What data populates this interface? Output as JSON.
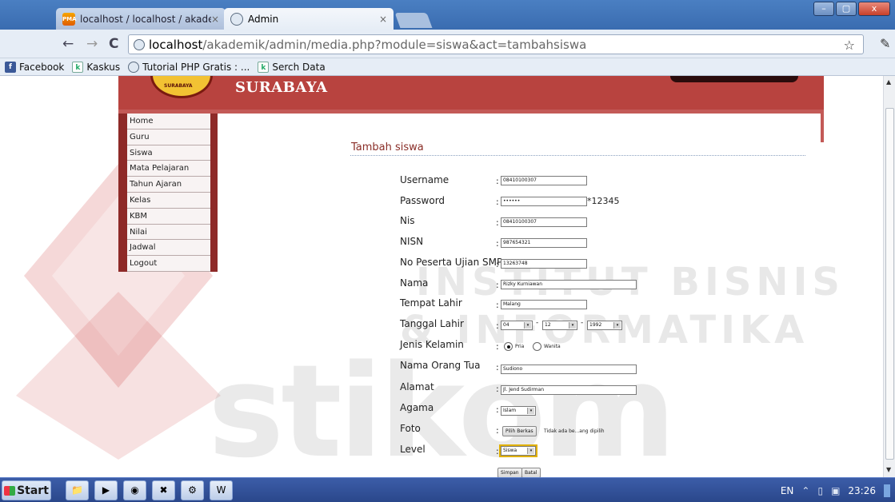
{
  "browser": {
    "tabs": [
      {
        "title": "localhost / localhost / akademi",
        "favicon": "phpmyadmin-icon",
        "active": false
      },
      {
        "title": "Admin",
        "favicon": "globe-icon",
        "active": true
      }
    ],
    "tab_close_glyph": "×",
    "address": {
      "host": "localhost",
      "path": "/akademik/admin/media.php?module=siswa&act=tambahsiswa"
    },
    "bookmarks": [
      {
        "label": "Facebook",
        "icon": "facebook-icon"
      },
      {
        "label": "Kaskus",
        "icon": "kaskus-icon"
      },
      {
        "label": "Tutorial PHP Gratis : ...",
        "icon": "globe-icon"
      },
      {
        "label": "Serch Data",
        "icon": "kaskus-icon"
      }
    ],
    "window_buttons": {
      "minimize": "–",
      "maximize": "▢",
      "close": "x"
    }
  },
  "site": {
    "brand": "SURABAYA",
    "seal_text": "SURABAYA"
  },
  "menu": {
    "items": [
      "Home",
      "Guru",
      "Siswa",
      "Mata Pelajaran",
      "Tahun Ajaran",
      "Kelas",
      "KBM",
      "Nilai",
      "Jadwal",
      "Logout"
    ]
  },
  "form": {
    "title": "Tambah siswa",
    "colon": ":",
    "username": {
      "label": "Username",
      "value": "08410100307"
    },
    "password": {
      "label": "Password",
      "value": "••••••",
      "hint": "*12345"
    },
    "nis": {
      "label": "Nis",
      "value": "08410100307"
    },
    "nisn": {
      "label": "NISN",
      "value": "987654321"
    },
    "no_peserta": {
      "label": "No Peserta Ujian SMP",
      "value": "13263748"
    },
    "nama": {
      "label": "Nama",
      "value": "Rizky Kurniawan"
    },
    "tempat_lahir": {
      "label": "Tempat Lahir",
      "value": "Malang"
    },
    "tanggal_lahir": {
      "label": "Tanggal Lahir",
      "day": "04",
      "month": "12",
      "year": "1992",
      "separator": "-"
    },
    "jenis_kelamin": {
      "label": "Jenis Kelamin",
      "options": [
        "Pria",
        "Wanita"
      ],
      "selected": "Pria"
    },
    "nama_ortu": {
      "label": "Nama Orang Tua",
      "value": "Sudiono"
    },
    "alamat": {
      "label": "Alamat",
      "value": "Jl. Jend Sudirman"
    },
    "agama": {
      "label": "Agama",
      "value": "Islam"
    },
    "foto": {
      "label": "Foto",
      "button": "Pilih Berkas",
      "note": "Tidak ada be...ang dipilih"
    },
    "level": {
      "label": "Level",
      "value": "Siswa"
    },
    "submit": "Simpan",
    "cancel": "Batal"
  },
  "watermark": {
    "line1": "INSTITUT BISNIS",
    "line2": "& INFORMATIKA",
    "big": "stikom"
  },
  "taskbar": {
    "start": "Start",
    "apps": [
      "folder-icon",
      "media-player-icon",
      "chrome-icon",
      "xampp-icon",
      "network-icon",
      "word-icon"
    ],
    "language": "EN",
    "clock": "23:26"
  }
}
